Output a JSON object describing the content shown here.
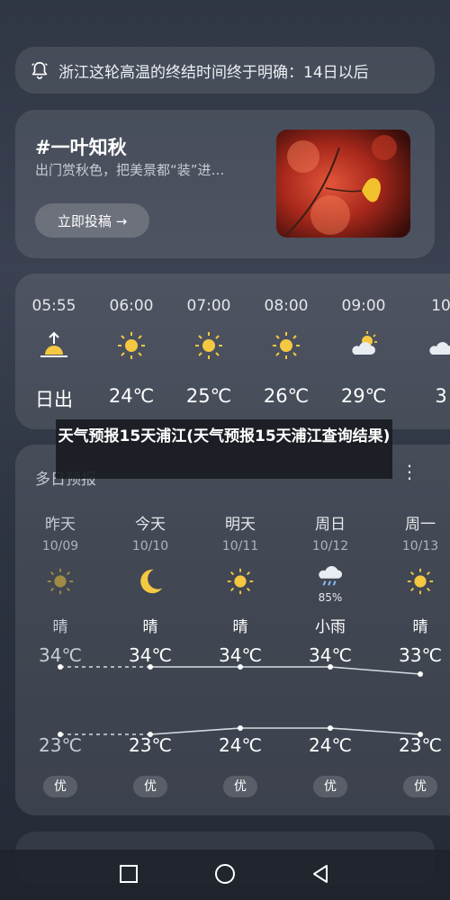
{
  "alert": {
    "icon": "bell-icon",
    "text": "浙江这轮高温的终结时间终于明确：14日以后"
  },
  "promo": {
    "title": "#一叶知秋",
    "subtitle": "出门赏秋色，把美景都“装”进…",
    "button_label": "立即投稿 →",
    "image": "autumn-leaf-photo"
  },
  "hourly": [
    {
      "time": "05:55",
      "icon": "sunrise-icon",
      "value": "日出"
    },
    {
      "time": "06:00",
      "icon": "sun-icon",
      "value": "24℃"
    },
    {
      "time": "07:00",
      "icon": "sun-icon",
      "value": "25℃"
    },
    {
      "time": "08:00",
      "icon": "sun-icon",
      "value": "26℃"
    },
    {
      "time": "09:00",
      "icon": "partly-cloudy-icon",
      "value": "29℃"
    },
    {
      "time": "10",
      "icon": "partly-cloudy-icon",
      "value": "3"
    }
  ],
  "daily": {
    "header": "多日预报",
    "more_icon": "⋮",
    "days": [
      {
        "day": "昨天",
        "date": "10/09",
        "icon": "sun-icon",
        "precip": "",
        "cond": "晴",
        "hi": "34℃",
        "lo": "23℃",
        "aqi": "优",
        "hi_val": 34,
        "lo_val": 23,
        "past": true
      },
      {
        "day": "今天",
        "date": "10/10",
        "icon": "moon-icon",
        "precip": "",
        "cond": "晴",
        "hi": "34℃",
        "lo": "23℃",
        "aqi": "优",
        "hi_val": 34,
        "lo_val": 23,
        "past": false
      },
      {
        "day": "明天",
        "date": "10/11",
        "icon": "sun-icon",
        "precip": "",
        "cond": "晴",
        "hi": "34℃",
        "lo": "24℃",
        "aqi": "优",
        "hi_val": 34,
        "lo_val": 24,
        "past": false
      },
      {
        "day": "周日",
        "date": "10/12",
        "icon": "rain-cloud-icon",
        "precip": "85%",
        "cond": "小雨",
        "hi": "34℃",
        "lo": "24℃",
        "aqi": "优",
        "hi_val": 34,
        "lo_val": 24,
        "past": false
      },
      {
        "day": "周一",
        "date": "10/13",
        "icon": "sun-icon",
        "precip": "",
        "cond": "晴",
        "hi": "33℃",
        "lo": "23℃",
        "aqi": "优",
        "hi_val": 33,
        "lo_val": 23,
        "past": false
      }
    ]
  },
  "caption": "天气预报15天浦江(天气预报15天浦江查询结果)",
  "nav": {
    "recent": "square-icon",
    "home": "circle-icon",
    "back": "triangle-back-icon"
  }
}
